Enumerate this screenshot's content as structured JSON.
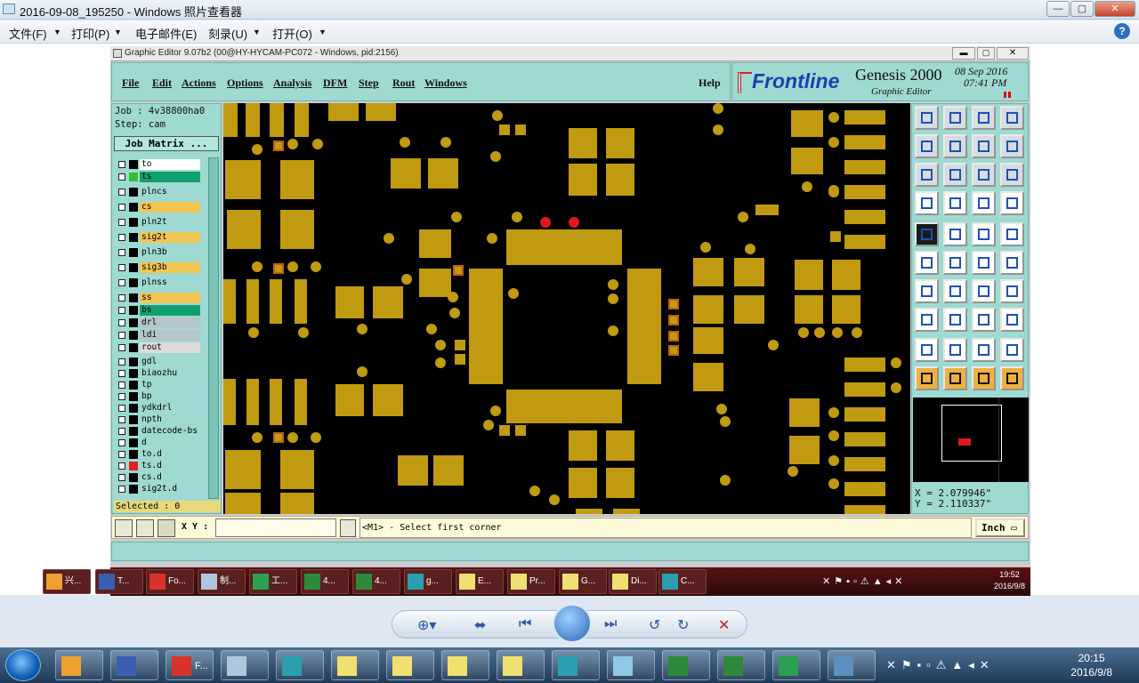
{
  "window": {
    "title": "2016-09-08_195250 - Windows 照片查看器",
    "min": "—",
    "max": "▢",
    "close": "✕"
  },
  "photo_menu": {
    "items": [
      "文件(F)",
      "打印(P)",
      "电子邮件(E)",
      "刻录(U)",
      "打开(O)"
    ],
    "help": "?"
  },
  "ge": {
    "title": "Graphic Editor 9.07b2 (00@HY-HYCAM-PC072 - Windows, pid:2156)",
    "menu": [
      "File",
      "Edit",
      "Actions",
      "Options",
      "Analysis",
      "DFM",
      "Step",
      "Rout",
      "Windows"
    ],
    "help": "Help",
    "brand": {
      "logo": "Frontline",
      "product": "Genesis 2000",
      "sub": "Graphic Editor",
      "date": "08 Sep 2016",
      "time": "07:41 PM"
    },
    "job": "Job : 4v38800ha0",
    "step": "Step: cam",
    "job_matrix": "Job Matrix ...",
    "layers": [
      {
        "name": "to",
        "bg": "#ffffff",
        "sw": "#000000"
      },
      {
        "name": "ts",
        "bg": "#10a070",
        "sw": "#30c030"
      },
      {
        "name": "plncs",
        "bg": "#9ed9d2",
        "sw": "#000000"
      },
      {
        "name": "cs",
        "bg": "#f2c552",
        "sw": "#000000"
      },
      {
        "name": "pln2t",
        "bg": "#9ed9d2",
        "sw": "#000000"
      },
      {
        "name": "sig2t",
        "bg": "#f2c552",
        "sw": "#000000"
      },
      {
        "name": "pln3b",
        "bg": "#9ed9d2",
        "sw": "#000000"
      },
      {
        "name": "sig3b",
        "bg": "#f2c552",
        "sw": "#000000"
      },
      {
        "name": "plnss",
        "bg": "#9ed9d2",
        "sw": "#000000"
      },
      {
        "name": "ss",
        "bg": "#f2c552",
        "sw": "#000000"
      },
      {
        "name": "bs",
        "bg": "#10a070",
        "sw": "#000000"
      },
      {
        "name": "drl",
        "bg": "#b8c4cc",
        "sw": "#000000"
      },
      {
        "name": "ldi",
        "bg": "#b8c4cc",
        "sw": "#000000"
      },
      {
        "name": "rout",
        "bg": "#dcdcdc",
        "sw": "#000000"
      },
      {
        "name": "gdl",
        "bg": "#9ed9d2",
        "sw": "#000000"
      },
      {
        "name": "biaozhu",
        "bg": "#9ed9d2",
        "sw": "#000000"
      },
      {
        "name": "tp",
        "bg": "#9ed9d2",
        "sw": "#000000"
      },
      {
        "name": "bp",
        "bg": "#9ed9d2",
        "sw": "#000000"
      },
      {
        "name": "ydkdrl",
        "bg": "#9ed9d2",
        "sw": "#000000"
      },
      {
        "name": "npth",
        "bg": "#9ed9d2",
        "sw": "#000000"
      },
      {
        "name": "datecode-bs",
        "bg": "#9ed9d2",
        "sw": "#000000"
      },
      {
        "name": "d",
        "bg": "#9ed9d2",
        "sw": "#000000"
      },
      {
        "name": "to.d",
        "bg": "#9ed9d2",
        "sw": "#000000"
      },
      {
        "name": "ts.d",
        "bg": "#9ed9d2",
        "sw": "#e02020"
      },
      {
        "name": "cs.d",
        "bg": "#9ed9d2",
        "sw": "#000000"
      },
      {
        "name": "sig2t.d",
        "bg": "#9ed9d2",
        "sw": "#000000"
      }
    ],
    "selected": "Selected : 0",
    "xy_label": "X Y :",
    "xy_value": "",
    "prompt": "<M1> - Select first corner",
    "unit": "Inch ▭",
    "coord_x": "X = 2.079946\"",
    "coord_y": "Y = 2.110337\"",
    "pad_color": "#c09a10",
    "highlight_color": "#e01818"
  },
  "inner_taskbar": {
    "items": [
      "兴...",
      "T...",
      "Fo...",
      "制...",
      "工...",
      "4...",
      "4...",
      "g...",
      "E...",
      "Pr...",
      "G...",
      "Di...",
      "C..."
    ],
    "time": "19:52",
    "date": "2016/9/8"
  },
  "taskbar": {
    "items": [
      "",
      "",
      "F...",
      "",
      "",
      "",
      "",
      "",
      "",
      "",
      "",
      "",
      "",
      "",
      ""
    ],
    "time": "20:15",
    "date": "2016/9/8"
  }
}
